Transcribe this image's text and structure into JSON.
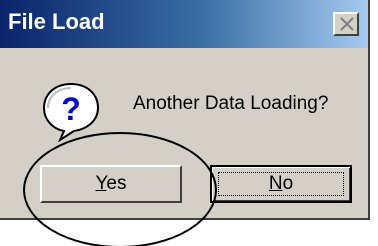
{
  "dialog": {
    "title": "File Load",
    "message": "Another Data Loading?",
    "close_icon": "close-icon",
    "question_icon": "question-icon"
  },
  "buttons": {
    "yes_label": "Yes",
    "no_label": "No"
  },
  "colors": {
    "title_bar_start": "#0a246a",
    "title_bar_end": "#a6caf0",
    "dialog_face": "#d4d0c8",
    "annotation_ellipse": "#000000"
  }
}
